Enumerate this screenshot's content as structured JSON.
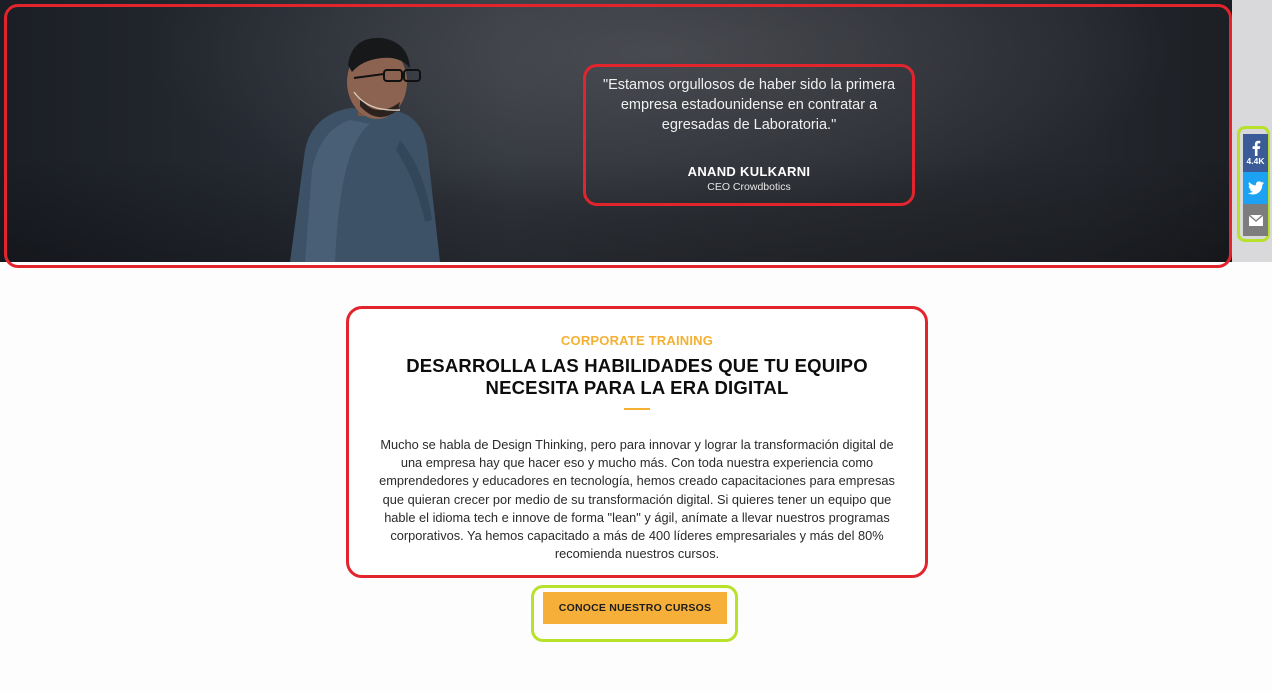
{
  "hero": {
    "quote": "\"Estamos orgullosos de haber sido la primera empresa estadounidense en contratar a egresadas de Laboratoria.\"",
    "name": "ANAND KULKARNI",
    "role": "CEO Crowdbotics"
  },
  "social": {
    "facebook_count": "4.4K",
    "icons": [
      "facebook-icon",
      "twitter-icon",
      "email-icon"
    ],
    "colors": {
      "facebook": "#3b5a98",
      "twitter": "#1da1f2",
      "email": "#7d7d7d"
    }
  },
  "section": {
    "eyebrow": "CORPORATE TRAINING",
    "heading": "DESARROLLA LAS HABILIDADES QUE TU EQUIPO NECESITA PARA LA ERA DIGITAL",
    "body": "Mucho se habla de Design Thinking, pero para innovar y lograr la transformación digital de una empresa hay que hacer eso y mucho más. Con toda nuestra experiencia como emprendedores y educadores en tecnología, hemos creado capacitaciones para empresas que quieran crecer por medio de su transformación digital. Si quieres tener un equipo que hable el idioma tech e innove de forma \"lean\" y ágil, anímate a llevar nuestros programas corporativos. Ya hemos capacitado a más de 400 líderes empresariales y más del 80% recomienda nuestros cursos.",
    "cta_label": "CONOCE NUESTRO CURSOS"
  },
  "colors": {
    "accent": "#f5b034",
    "highlight_red": "#e2252d",
    "highlight_green": "#b7e12a"
  }
}
